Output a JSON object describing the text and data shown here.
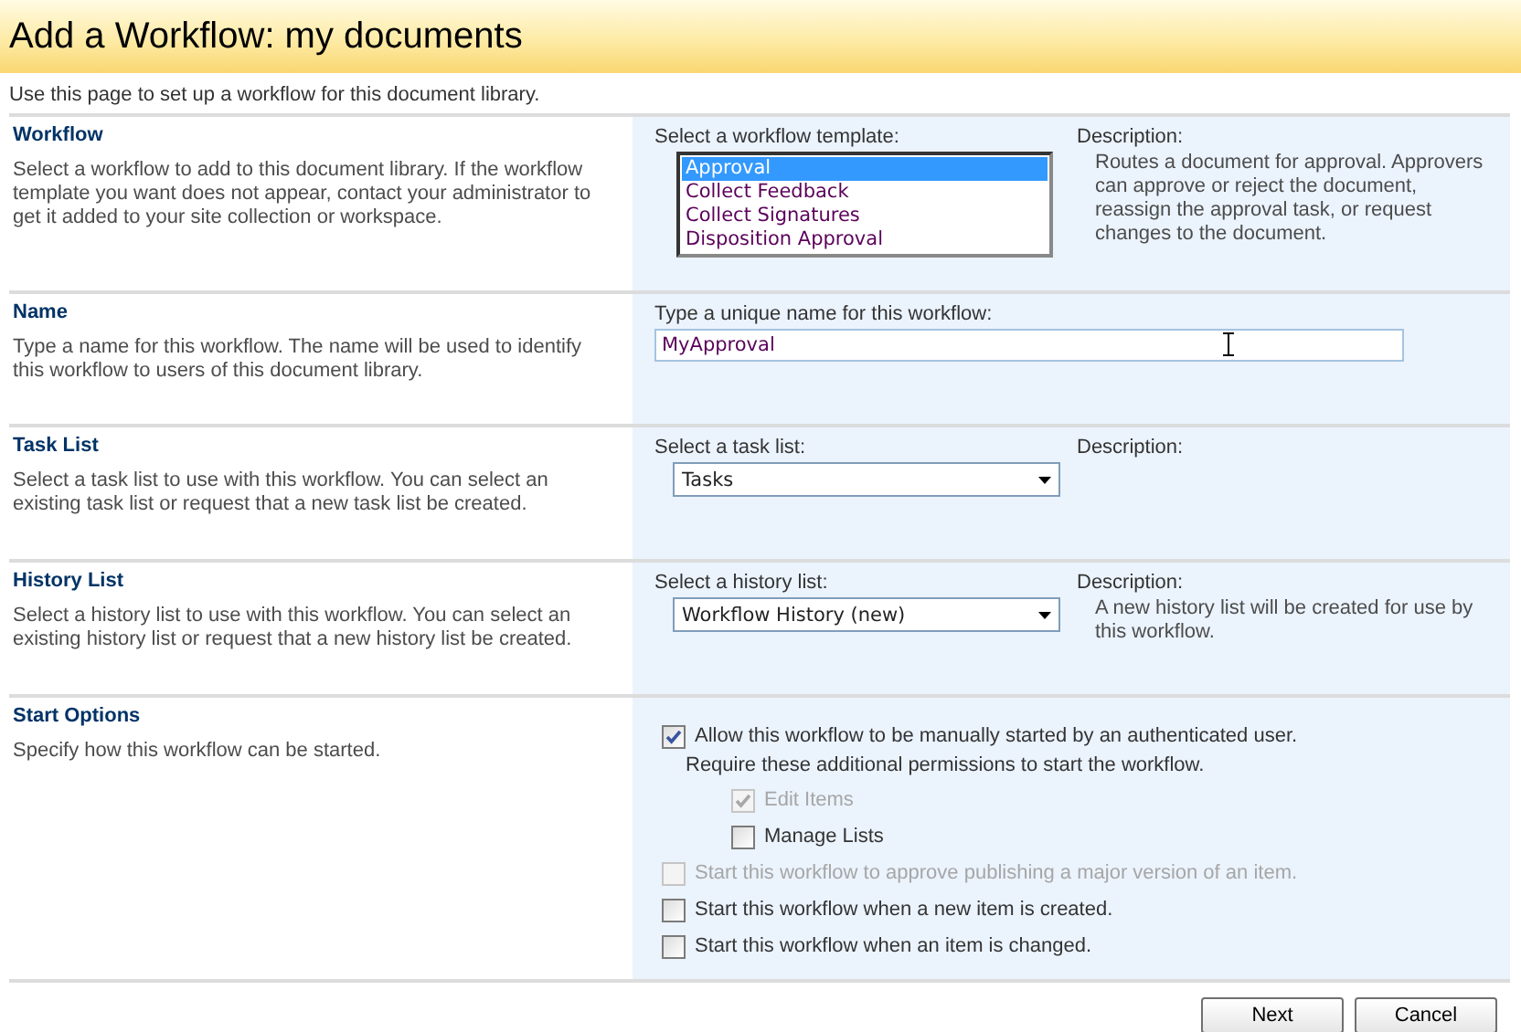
{
  "page": {
    "title": "Add a Workflow: my documents",
    "intro": "Use this page to set up a workflow for this document library."
  },
  "sections": [
    {
      "kind": "listbox",
      "heading": "Workflow",
      "description": "Select a workflow to add to this document library. If the workflow template you want does not appear, contact your administrator to get it added to your site collection or workspace.",
      "field_label": "Select a workflow template:",
      "options": [
        {
          "label": "Approval",
          "selected": true
        },
        {
          "label": "Collect Feedback",
          "selected": false
        },
        {
          "label": "Collect Signatures",
          "selected": false
        },
        {
          "label": "Disposition Approval",
          "selected": false
        }
      ],
      "side_label": "Description:",
      "side_text": "Routes a document for approval. Approvers can approve or reject the document, reassign the approval task, or request changes to the document."
    },
    {
      "kind": "text",
      "heading": "Name",
      "description": "Type a name for this workflow. The name will be used to identify this workflow to users of this document library.",
      "field_label": "Type a unique name for this workflow:",
      "value": "MyApproval"
    },
    {
      "kind": "dropdown",
      "heading": "Task List",
      "description": "Select a task list to use with this workflow. You can select an existing task list or request that a new task list be created.",
      "field_label": "Select a task list:",
      "value": "Tasks",
      "side_label": "Description:"
    },
    {
      "kind": "dropdown",
      "heading": "History List",
      "description": "Select a history list to use with this workflow. You can select an existing history list or request that a new history list be created.",
      "field_label": "Select a history list:",
      "value": "Workflow History (new)",
      "side_label": "Description:",
      "side_text": "A new history list will be created for use by this workflow."
    },
    {
      "kind": "checkboxes",
      "heading": "Start Options",
      "description": "Specify how this workflow can be started.",
      "options": [
        {
          "label": "Allow this workflow to be manually started by an authenticated user.",
          "checked": true,
          "disabled": false,
          "note": "Require these additional permissions to start the workflow.",
          "children": [
            {
              "label": "Edit Items",
              "checked": true,
              "disabled": true
            },
            {
              "label": "Manage Lists",
              "checked": false,
              "disabled": false
            }
          ]
        },
        {
          "label": "Start this workflow to approve publishing a major version of an item.",
          "checked": false,
          "disabled": true
        },
        {
          "label": "Start this workflow when a new item is created.",
          "checked": false,
          "disabled": false
        },
        {
          "label": "Start this workflow when an item is changed.",
          "checked": false,
          "disabled": false
        }
      ]
    }
  ],
  "buttons": [
    "Next",
    "Cancel"
  ]
}
